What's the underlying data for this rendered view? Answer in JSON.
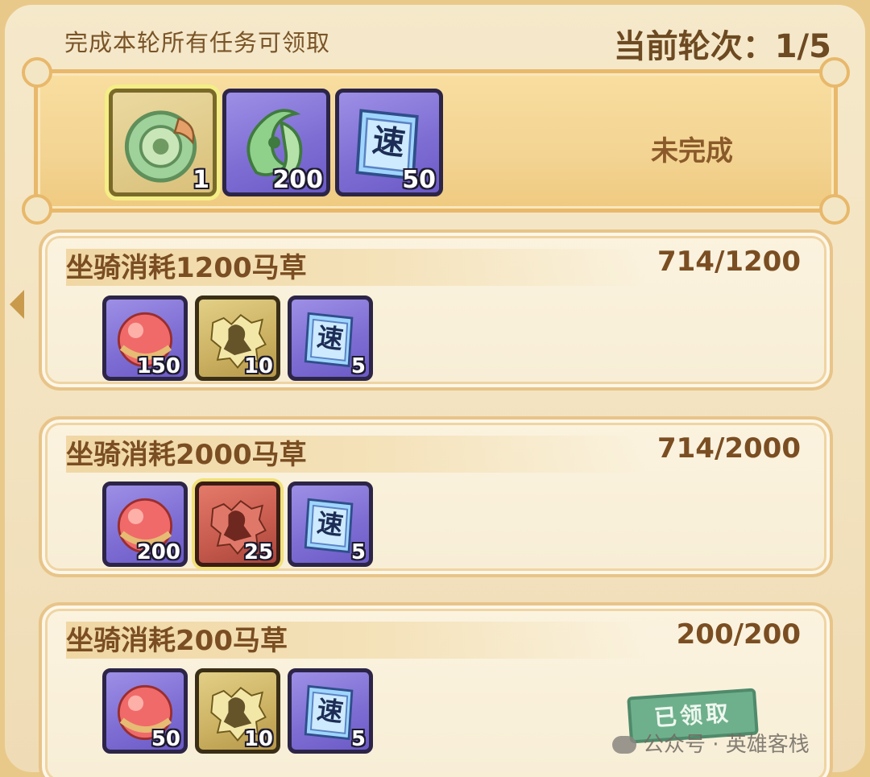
{
  "header": {
    "note": "完成本轮所有任务可领取",
    "round_label": "当前轮次：",
    "round_value": "1/5"
  },
  "round_reward": {
    "status": "未完成",
    "items": [
      {
        "icon": "jade-ring-icon",
        "qty": "1",
        "frame": "gold-highlight"
      },
      {
        "icon": "jade-pendant-icon",
        "qty": "200",
        "frame": "purple"
      },
      {
        "icon": "speed-ticket-icon",
        "qty": "50",
        "frame": "purple"
      }
    ]
  },
  "tasks": [
    {
      "title": "坐骑消耗1200马草",
      "progress": "714/1200",
      "items": [
        {
          "icon": "red-orb-icon",
          "qty": "150",
          "frame": "purple"
        },
        {
          "icon": "silhouette-shard-icon",
          "qty": "10",
          "frame": "gold"
        },
        {
          "icon": "speed-ticket-icon",
          "qty": "5",
          "frame": "purple"
        }
      ]
    },
    {
      "title": "坐骑消耗2000马草",
      "progress": "714/2000",
      "items": [
        {
          "icon": "red-orb-icon",
          "qty": "200",
          "frame": "purple"
        },
        {
          "icon": "silhouette-shard-icon",
          "qty": "25",
          "frame": "red"
        },
        {
          "icon": "speed-ticket-icon",
          "qty": "5",
          "frame": "purple"
        }
      ]
    },
    {
      "title": "坐骑消耗200马草",
      "progress": "200/200",
      "items": [
        {
          "icon": "red-orb-icon",
          "qty": "50",
          "frame": "purple"
        },
        {
          "icon": "silhouette-shard-icon",
          "qty": "10",
          "frame": "gold"
        },
        {
          "icon": "speed-ticket-icon",
          "qty": "5",
          "frame": "purple"
        }
      ],
      "claimed_label": "已领取"
    }
  ],
  "watermark": "公众号 · 英雄客栈",
  "ticket_glyph": "速",
  "colors": {
    "panel_bg": "#f3e6c4",
    "title_text": "#7a4e22",
    "claimed_green": "#6fb08c",
    "purple_frame": "#7f6fd4"
  }
}
